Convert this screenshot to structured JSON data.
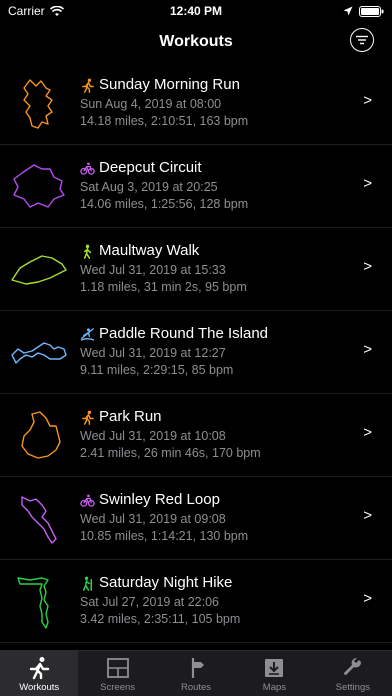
{
  "status": {
    "carrier": "Carrier",
    "time": "12:40 PM"
  },
  "nav": {
    "title": "Workouts"
  },
  "workouts": [
    {
      "title": "Sunday Morning Run",
      "date": "Sun Aug 4, 2019 at 08:00",
      "stats": "14.18 miles, 2:10:51, 163 bpm",
      "color": "#f7941d",
      "activity_icon": "running-icon"
    },
    {
      "title": "Deepcut Circuit",
      "date": "Sat Aug 3, 2019 at 20:25",
      "stats": "14.06 miles, 1:25:56, 128 bpm",
      "color": "#b44cf0",
      "activity_icon": "cycling-icon"
    },
    {
      "title": "Maultway Walk",
      "date": "Wed Jul 31, 2019 at 15:33",
      "stats": "1.18 miles, 31 min 2s, 95 bpm",
      "color": "#a6e22e",
      "activity_icon": "walking-icon"
    },
    {
      "title": "Paddle Round The Island",
      "date": "Wed Jul 31, 2019 at 12:27",
      "stats": "9.11 miles, 2:29:15, 85 bpm",
      "color": "#4aa3ff",
      "activity_icon": "paddling-icon"
    },
    {
      "title": "Park Run",
      "date": "Wed Jul 31, 2019 at 10:08",
      "stats": "2.41 miles, 26 min 46s, 170 bpm",
      "color": "#f7941d",
      "activity_icon": "running-icon"
    },
    {
      "title": "Swinley Red Loop",
      "date": "Wed Jul 31, 2019 at 09:08",
      "stats": "10.85 miles, 1:14:21, 130 bpm",
      "color": "#c65ff0",
      "activity_icon": "cycling-icon"
    },
    {
      "title": "Saturday Night Hike",
      "date": "Sat Jul 27, 2019 at 22:06",
      "stats": "3.42 miles, 2:35:11, 105 bpm",
      "color": "#2bd14b",
      "activity_icon": "hiking-icon"
    }
  ],
  "chevron": ">",
  "tabs": [
    {
      "label": "Workouts",
      "icon": "running-icon",
      "active": true
    },
    {
      "label": "Screens",
      "icon": "screens-grid-icon",
      "active": false
    },
    {
      "label": "Routes",
      "icon": "routes-signpost-icon",
      "active": false
    },
    {
      "label": "Maps",
      "icon": "maps-download-icon",
      "active": false
    },
    {
      "label": "Settings",
      "icon": "wrench-icon",
      "active": false
    }
  ]
}
